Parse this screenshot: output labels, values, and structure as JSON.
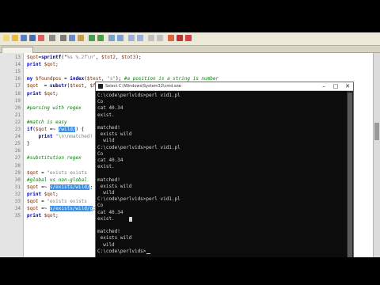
{
  "editor": {
    "lines": [
      {
        "n": "13",
        "parts": [
          [
            "var",
            "$qot"
          ],
          [
            "op",
            "="
          ],
          [
            "fn",
            "sprintf"
          ],
          [
            "op",
            "(\""
          ],
          [
            "str",
            "%s %.2f\\n\""
          ],
          [
            "op",
            ", "
          ],
          [
            "var",
            "$tot2"
          ],
          [
            "op",
            ", "
          ],
          [
            "var",
            "$tot3"
          ],
          [
            "op",
            ");"
          ]
        ]
      },
      {
        "n": "14",
        "parts": [
          [
            "kw",
            "print"
          ],
          [
            "op",
            " "
          ],
          [
            "var",
            "$qot"
          ],
          [
            "op",
            ";"
          ]
        ]
      },
      {
        "n": "15",
        "parts": []
      },
      {
        "n": "16",
        "parts": [
          [
            "kw",
            "my"
          ],
          [
            "op",
            " "
          ],
          [
            "var",
            "$foundpos"
          ],
          [
            "op",
            " = "
          ],
          [
            "fn",
            "index"
          ],
          [
            "op",
            "("
          ],
          [
            "var",
            "$test"
          ],
          [
            "op",
            ", "
          ],
          [
            "str",
            "\"s\""
          ],
          [
            "op",
            "); "
          ],
          [
            "cm",
            "#a position is a string is number"
          ]
        ]
      },
      {
        "n": "17",
        "parts": [
          [
            "var",
            "$qot"
          ],
          [
            "op",
            "  = "
          ],
          [
            "fn",
            "substr"
          ],
          [
            "op",
            "("
          ],
          [
            "var",
            "$test"
          ],
          [
            "op",
            ", "
          ],
          [
            "var",
            "$foundpos"
          ],
          [
            "op",
            ", "
          ],
          [
            "fn",
            "index"
          ],
          [
            "op",
            "("
          ],
          [
            "var",
            "$test"
          ],
          [
            "op",
            ", "
          ],
          [
            "str",
            "\".\""
          ],
          [
            "op",
            ", "
          ],
          [
            "var",
            "$foundpos"
          ],
          [
            "op",
            "));"
          ]
        ]
      },
      {
        "n": "18",
        "parts": [
          [
            "kw",
            "print"
          ],
          [
            "op",
            " "
          ],
          [
            "var",
            "$qot"
          ],
          [
            "op",
            ";"
          ]
        ]
      },
      {
        "n": "19",
        "parts": []
      },
      {
        "n": "20",
        "parts": [
          [
            "cm",
            "#parsing with regex"
          ]
        ]
      },
      {
        "n": "21",
        "parts": []
      },
      {
        "n": "22",
        "parts": [
          [
            "cm",
            "#match is easy"
          ]
        ]
      },
      {
        "n": "23",
        "parts": [
          [
            "kw",
            "if"
          ],
          [
            "op",
            "("
          ],
          [
            "var",
            "$qot"
          ],
          [
            "op",
            " =~ "
          ],
          [
            "sel",
            "/wild/"
          ],
          [
            "op",
            ") {"
          ]
        ]
      },
      {
        "n": "24",
        "parts": [
          [
            "op",
            "    "
          ],
          [
            "kw",
            "print"
          ],
          [
            "op",
            " "
          ],
          [
            "str",
            "\"\\n\\nmatched!"
          ]
        ]
      },
      {
        "n": "25",
        "parts": [
          [
            "op",
            "}"
          ]
        ]
      },
      {
        "n": "26",
        "parts": []
      },
      {
        "n": "27",
        "parts": [
          [
            "cm",
            "#substitution regex"
          ]
        ]
      },
      {
        "n": "28",
        "parts": []
      },
      {
        "n": "29",
        "parts": [
          [
            "var",
            "$qot"
          ],
          [
            "op",
            " = "
          ],
          [
            "str",
            "\"exists exists"
          ]
        ]
      },
      {
        "n": "30",
        "parts": [
          [
            "cm",
            "#global vs non-global"
          ]
        ]
      },
      {
        "n": "31",
        "parts": [
          [
            "var",
            "$qot"
          ],
          [
            "op",
            " =~ "
          ],
          [
            "sel",
            "s/exists/wild/"
          ],
          [
            "op",
            "; "
          ],
          [
            "cm",
            "#exist."
          ]
        ]
      },
      {
        "n": "32",
        "parts": [
          [
            "kw",
            "print"
          ],
          [
            "op",
            " "
          ],
          [
            "var",
            "$qot"
          ],
          [
            "op",
            ";"
          ]
        ]
      },
      {
        "n": "33",
        "parts": [
          [
            "var",
            "$qot"
          ],
          [
            "op",
            " = "
          ],
          [
            "str",
            "\"exists exists"
          ]
        ]
      },
      {
        "n": "34",
        "parts": [
          [
            "var",
            "$qot"
          ],
          [
            "op",
            " =~ "
          ],
          [
            "sel",
            "s/exists/wild/g"
          ],
          [
            "op",
            ";"
          ]
        ]
      },
      {
        "n": "35",
        "parts": [
          [
            "kw",
            "print"
          ],
          [
            "op",
            " "
          ],
          [
            "var",
            "$qot"
          ],
          [
            "op",
            ";"
          ]
        ]
      }
    ]
  },
  "console": {
    "title": "Select C:\\Windows\\System32\\cmd.exe",
    "controls": [
      "–",
      "□",
      "✕"
    ],
    "lines": [
      "C:\\code\\perlvids>perl vid1.pl",
      "Co",
      "cat 40.34",
      "exist.",
      "",
      "matched!",
      " exists wild",
      "  wild",
      "C:\\code\\perlvids>perl vid1.pl",
      "Co",
      "cat 40.34",
      "exist.",
      "",
      "matched!",
      " exists wild",
      "  wild",
      "C:\\code\\perlvids>perl vid1.pl",
      "Co",
      "cat 40.34",
      "exist.",
      "",
      "matched!",
      " exists wild",
      "  wild",
      "C:\\code\\perlvids>"
    ]
  },
  "colors": {
    "editor_bg": "#ffffff",
    "console_bg": "#0c0c0c",
    "selection": "#3a8ee6",
    "comment": "#008000",
    "keyword": "#0000c8"
  }
}
